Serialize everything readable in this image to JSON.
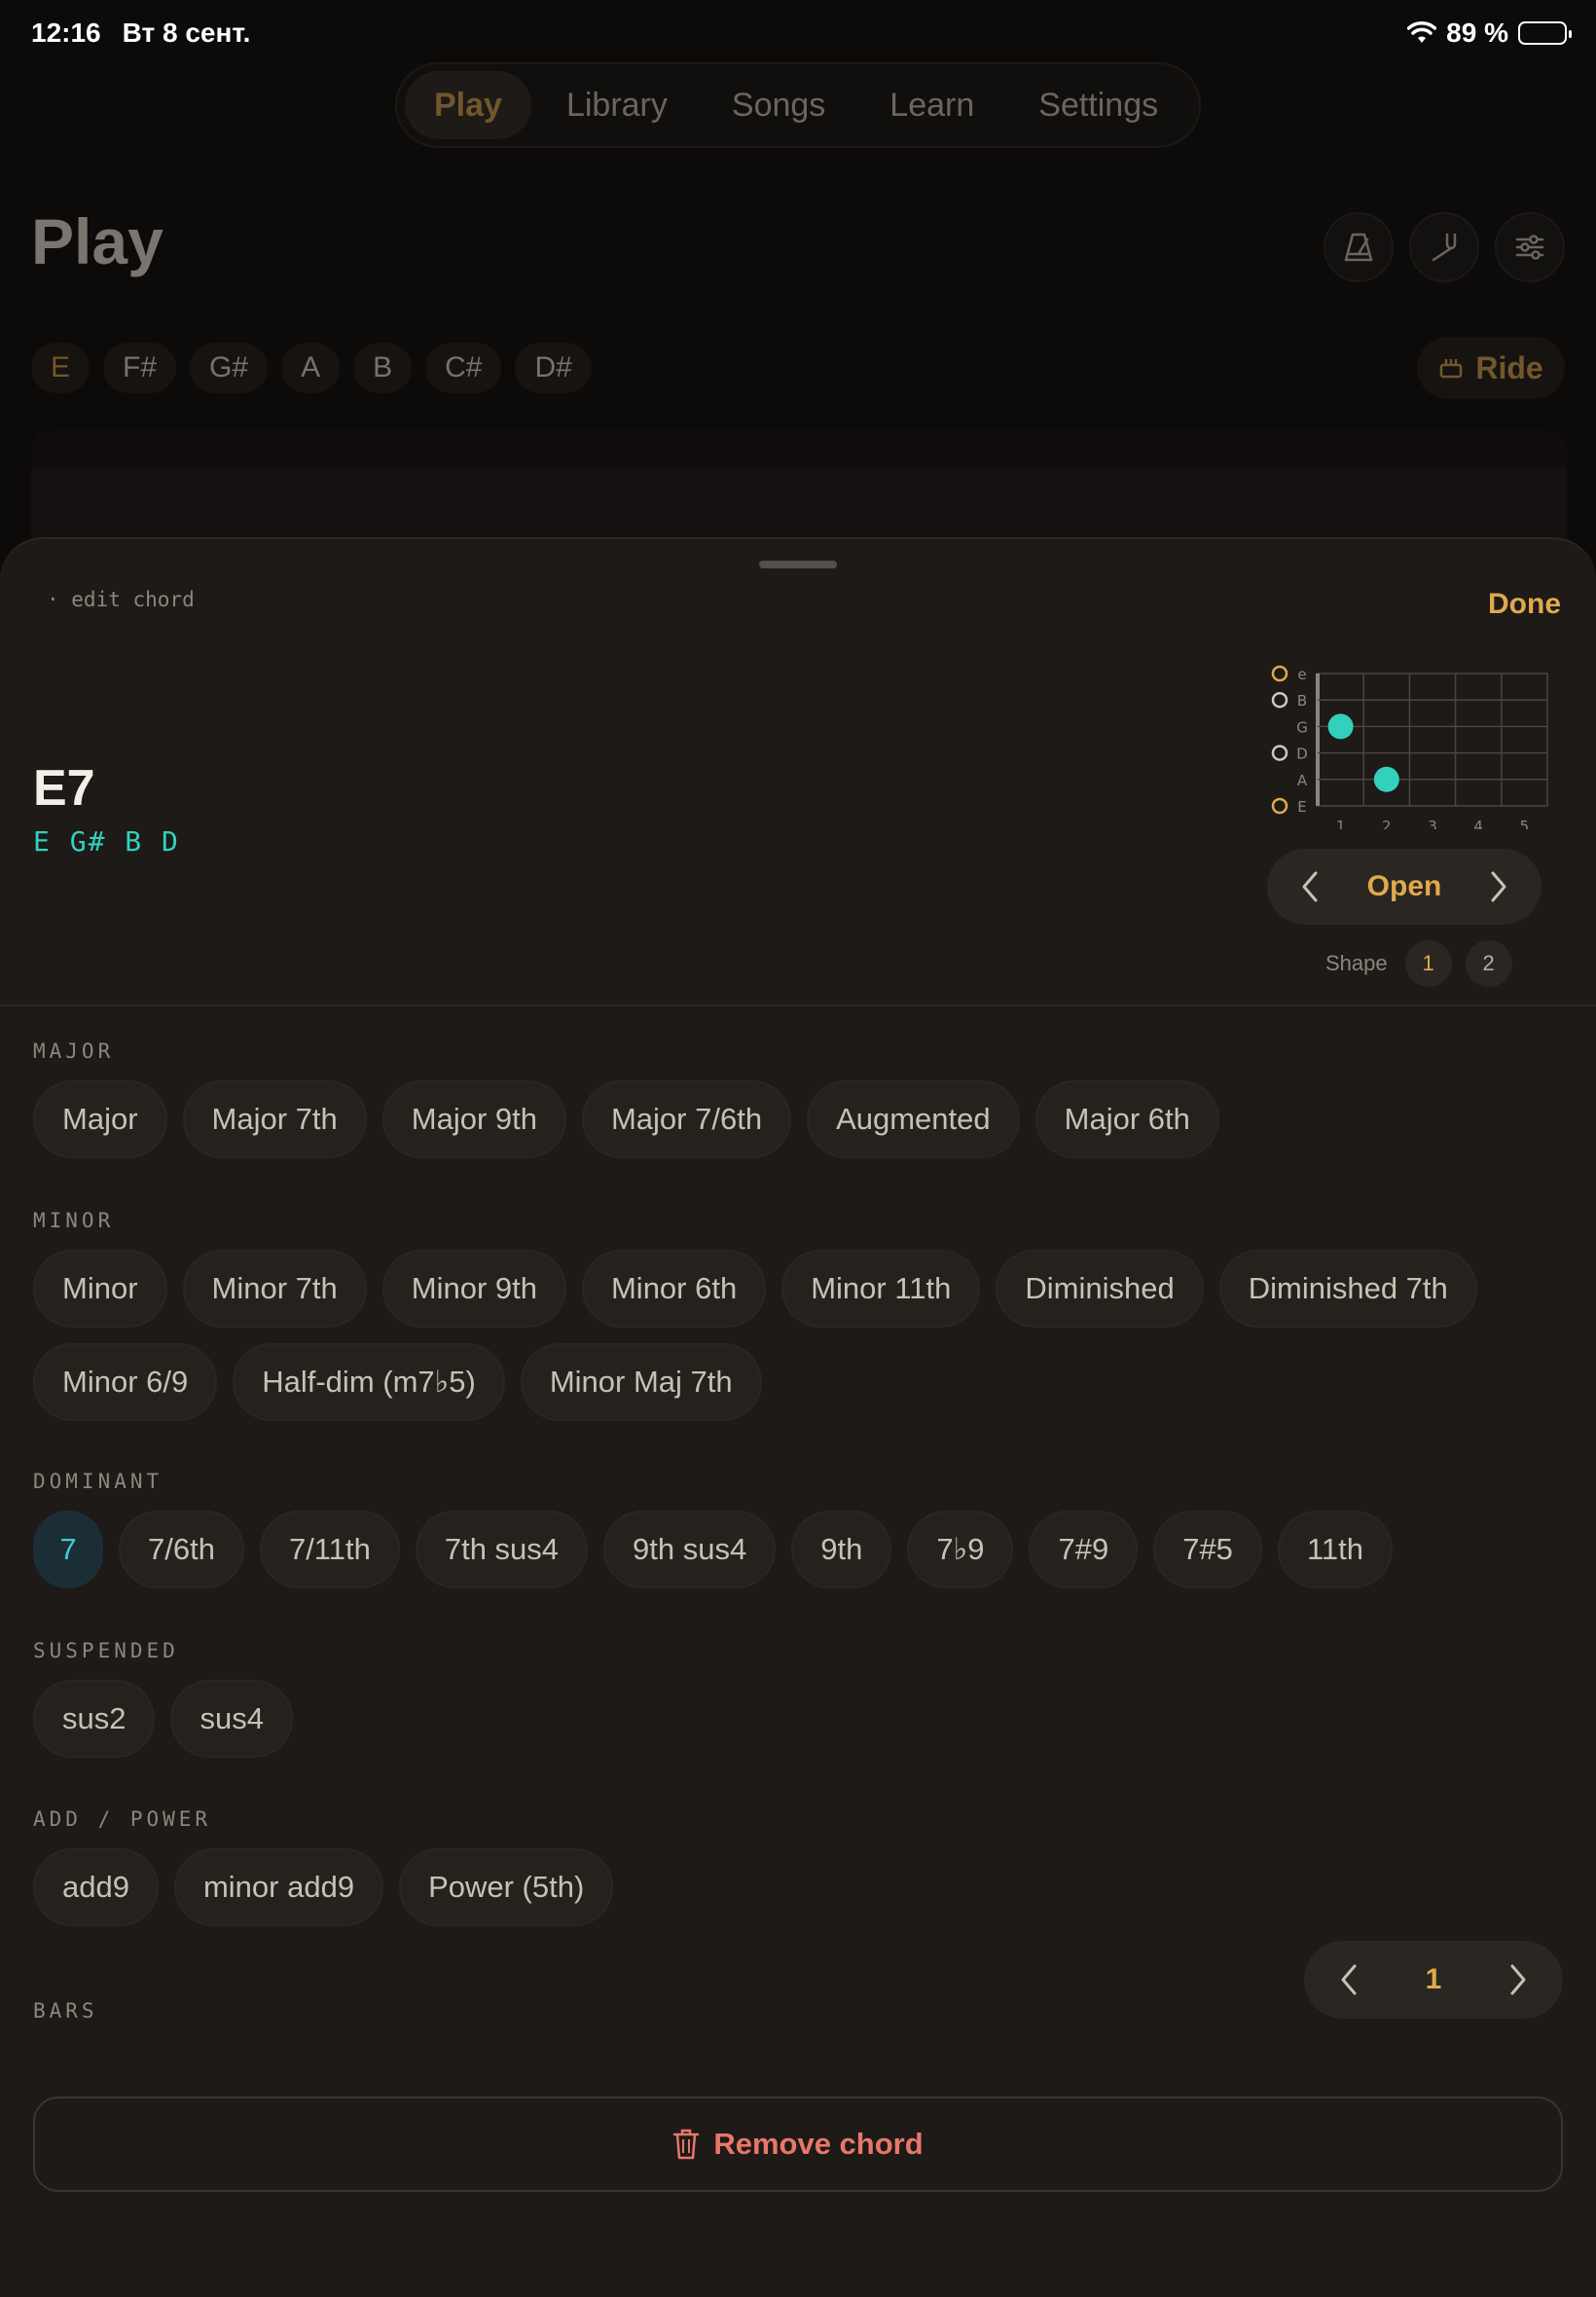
{
  "status": {
    "time": "12:16",
    "date": "Вт 8 сент.",
    "battery": "89 %",
    "battery_level": 0.89
  },
  "nav": {
    "tabs": [
      "Play",
      "Library",
      "Songs",
      "Learn",
      "Settings"
    ],
    "active": "Play"
  },
  "page": {
    "title": "Play",
    "keys": [
      "E",
      "F#",
      "G#",
      "A",
      "B",
      "C#",
      "D#"
    ],
    "active_key": "E",
    "ride_label": "Ride"
  },
  "sheet": {
    "breadcrumb": "· edit chord",
    "done_label": "Done",
    "chord": {
      "name": "E7",
      "notes": "E G# B D"
    },
    "diagram": {
      "strings": [
        "e",
        "B",
        "G",
        "D",
        "A",
        "E"
      ],
      "frets": [
        "1",
        "2",
        "3",
        "4",
        "5"
      ],
      "open_strings": [
        "e",
        "B",
        "D",
        "E"
      ],
      "dots": [
        {
          "string": "G",
          "fret": 1
        },
        {
          "string": "A",
          "fret": 2
        }
      ],
      "colors": {
        "dot": "#32d1be",
        "root_ring": "#e0a94b",
        "open_ring": "#cfc8bb"
      }
    },
    "voicing": {
      "label": "Open",
      "shape_label": "Shape",
      "shapes": [
        "1",
        "2"
      ],
      "selected_shape": "1"
    },
    "groups": [
      {
        "label": "MAJOR",
        "items": [
          "Major",
          "Major 7th",
          "Major 9th",
          "Major 7/6th",
          "Augmented",
          "Major 6th"
        ]
      },
      {
        "label": "MINOR",
        "items": [
          "Minor",
          "Minor 7th",
          "Minor 9th",
          "Minor 6th",
          "Minor 11th",
          "Diminished",
          "Diminished 7th",
          "Minor 6/9",
          "Half-dim (m7♭5)",
          "Minor Maj 7th"
        ]
      },
      {
        "label": "DOMINANT",
        "items": [
          "7",
          "7/6th",
          "7/11th",
          "7th sus4",
          "9th sus4",
          "9th",
          "7♭9",
          "7#9",
          "7#5",
          "11th"
        ]
      },
      {
        "label": "SUSPENDED",
        "items": [
          "sus2",
          "sus4"
        ]
      },
      {
        "label": "ADD / POWER",
        "items": [
          "add9",
          "minor add9",
          "Power (5th)"
        ]
      }
    ],
    "selected_quality": "7",
    "bars": {
      "label": "BARS",
      "value": "1"
    },
    "remove_label": "Remove chord"
  },
  "icons": {
    "tools": [
      "metronome-icon",
      "tuner-fork-icon",
      "sliders-icon"
    ],
    "ride": "drum-icon",
    "remove": "trash-icon"
  },
  "accent": "#e0a94b"
}
